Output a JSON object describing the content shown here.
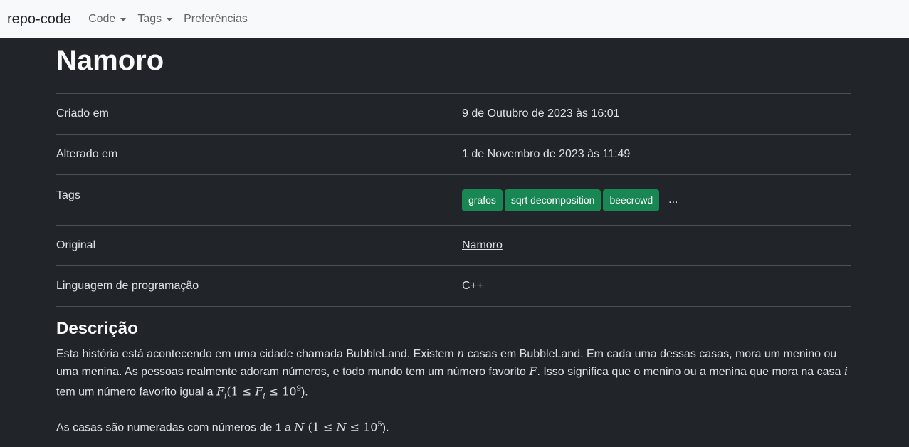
{
  "navbar": {
    "brand": "repo-code",
    "items": [
      {
        "label": "Code",
        "dropdown": true
      },
      {
        "label": "Tags",
        "dropdown": true
      },
      {
        "label": "Preferências",
        "dropdown": false
      }
    ]
  },
  "page": {
    "title": "Namoro",
    "rows": {
      "created": {
        "label": "Criado em",
        "value": "9 de Outubro de 2023 às 16:01"
      },
      "modified": {
        "label": "Alterado em",
        "value": "1 de Novembro de 2023 às 11:49"
      },
      "tags": {
        "label": "Tags",
        "items": [
          "grafos",
          "sqrt decomposition",
          "beecrowd"
        ],
        "more": "..."
      },
      "original": {
        "label": "Original",
        "link": "Namoro"
      },
      "language": {
        "label": "Linguagem de programação",
        "value": "C++"
      }
    },
    "description": {
      "heading": "Descrição",
      "p1": {
        "t1": "Esta história está acontecendo em uma cidade chamada BubbleLand. Existem ",
        "n": "n",
        "t2": " casas em BubbleLand. Em cada uma dessas casas, mora um menino ou uma menina. As pessoas realmente adoram números, e todo mundo tem um número favorito ",
        "F": "F",
        "t3": ". Isso significa que o menino ou a menina que mora na casa ",
        "i": "i",
        "t4": " tem um número favorito igual a ",
        "Fi": "F",
        "sub": "i",
        "range_open": "(1 ≤ ",
        "range_F": "F",
        "range_sub": "i",
        "range_mid": " ≤ 10",
        "range_sup": "9",
        "range_close": ").",
        "end": ""
      },
      "p2": {
        "t1": "As casas são numeradas com números de 1 a ",
        "N": "N",
        "t2": " (1 ≤ ",
        "N2": "N",
        "t3": " ≤ 10",
        "sup": "5",
        "t4": ")."
      }
    }
  },
  "colors": {
    "background": "#212529",
    "navbar": "#f8f9fa",
    "tag": "#198754"
  }
}
